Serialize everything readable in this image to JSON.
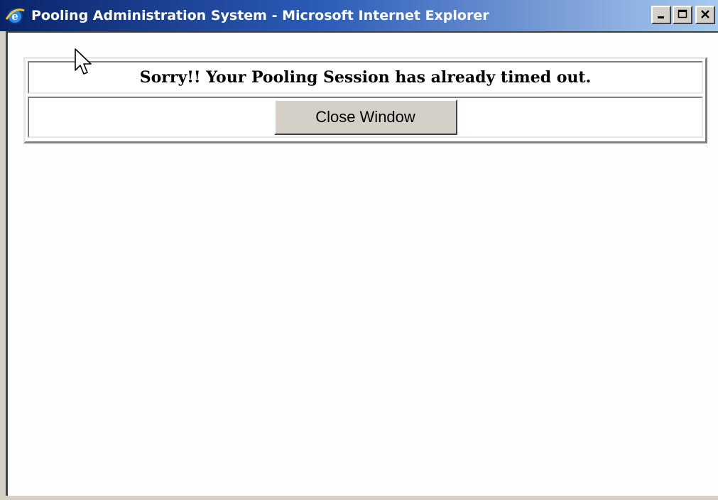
{
  "window": {
    "title": "Pooling Administration System - Microsoft Internet Explorer",
    "icon": "internet-explorer-icon",
    "controls": [
      "minimize-icon",
      "maximize-icon",
      "close-icon"
    ]
  },
  "page": {
    "message": "Sorry!! Your Pooling Session has already timed out.",
    "close_button_label": "Close Window"
  },
  "colors": {
    "titlebar_start": "#0a246a",
    "titlebar_end": "#a6caf0",
    "button_face": "#d4d0c8",
    "page_background": "#ffffff"
  }
}
